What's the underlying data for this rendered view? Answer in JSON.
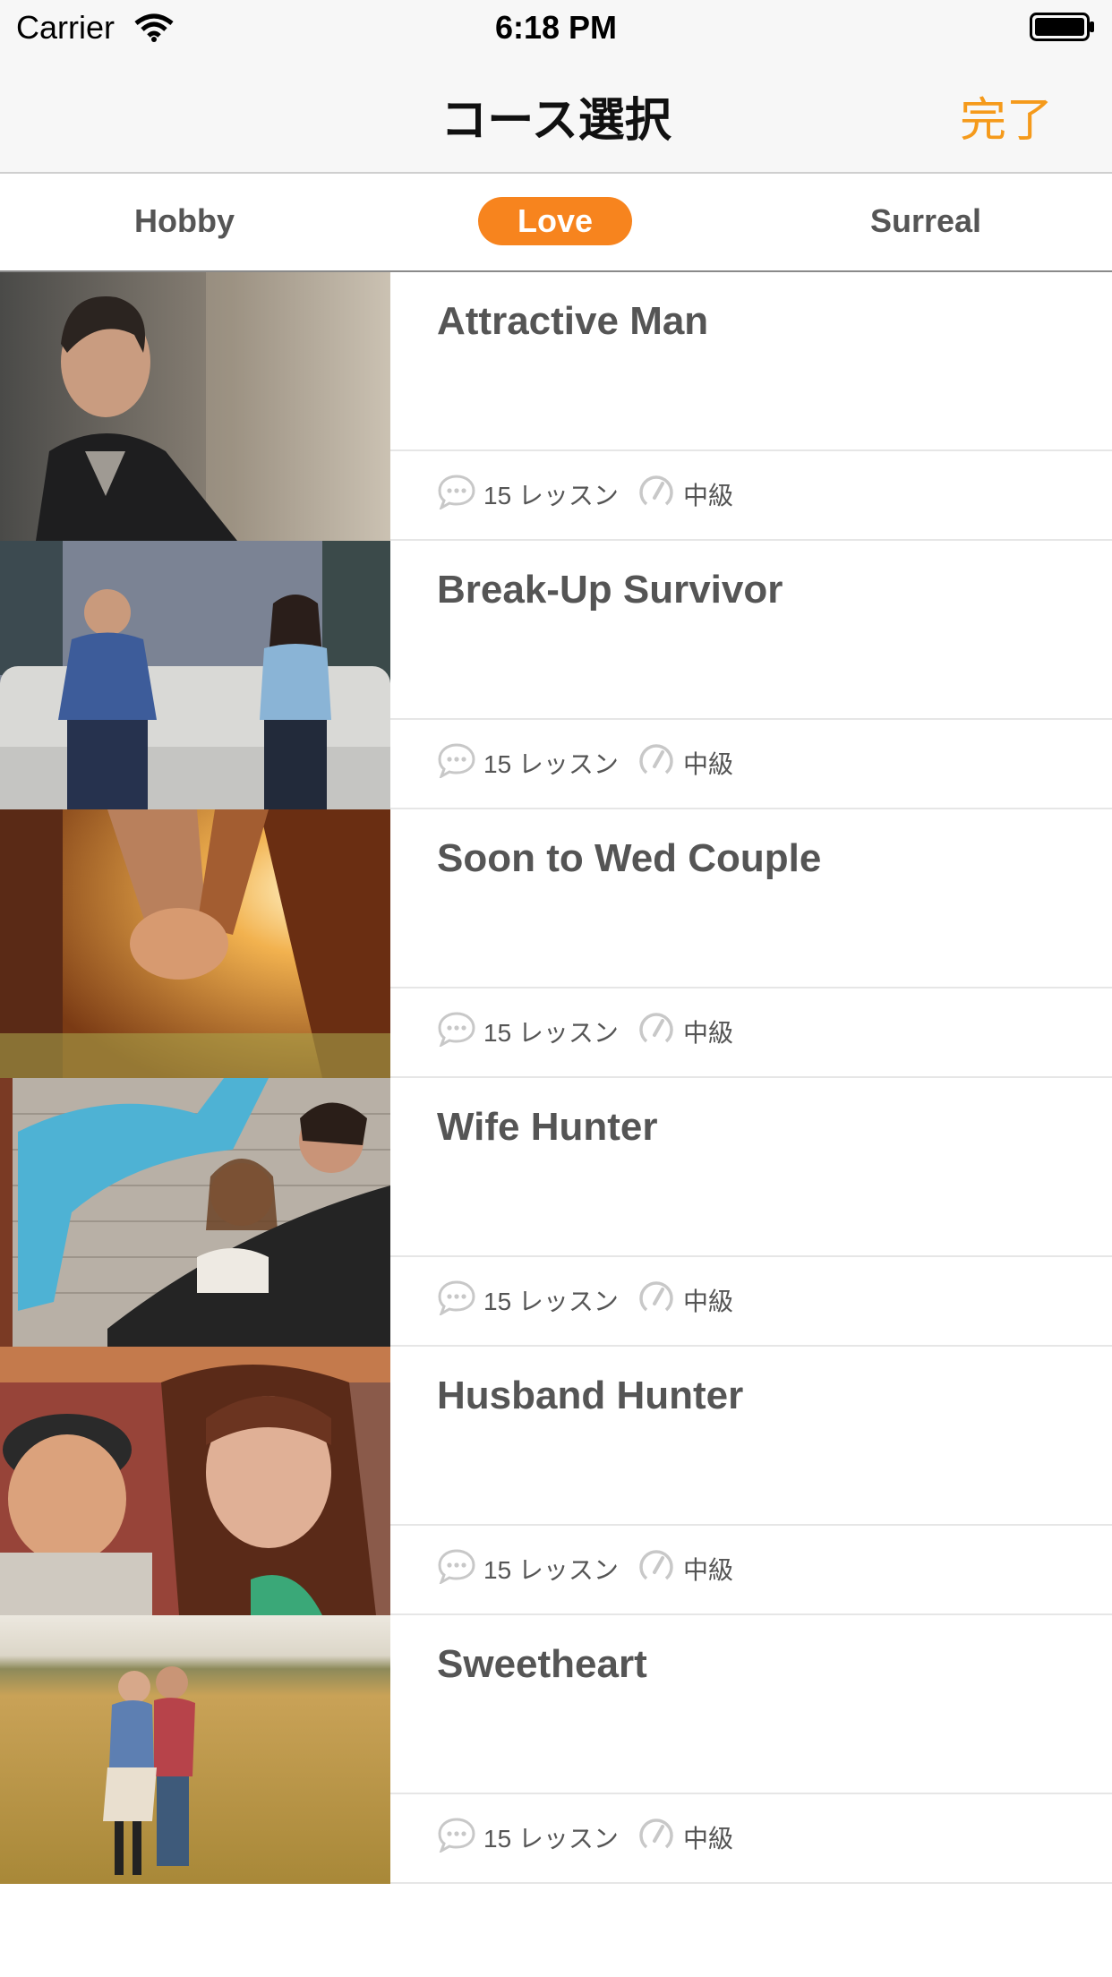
{
  "status_bar": {
    "carrier": "Carrier",
    "time": "6:18 PM"
  },
  "nav": {
    "title": "コース選択",
    "done_label": "完了"
  },
  "tabs": [
    {
      "label": "Hobby",
      "selected": false
    },
    {
      "label": "Love",
      "selected": true
    },
    {
      "label": "Surreal",
      "selected": false
    }
  ],
  "courses": [
    {
      "title": "Attractive Man",
      "lessons": "15 レッスン",
      "level": "中級",
      "image": "man-portrait-photo"
    },
    {
      "title": "Break-Up Survivor",
      "lessons": "15 レッスン",
      "level": "中級",
      "image": "couple-on-sofa-photo"
    },
    {
      "title": "Soon to Wed Couple",
      "lessons": "15 レッスン",
      "level": "中級",
      "image": "holding-hands-sunset-photo"
    },
    {
      "title": "Wife Hunter",
      "lessons": "15 レッスン",
      "level": "中級",
      "image": "couple-brick-wall-photo"
    },
    {
      "title": "Husband Hunter",
      "lessons": "15 レッスン",
      "level": "中級",
      "image": "couple-portrait-photo"
    },
    {
      "title": "Sweetheart",
      "lessons": "15 レッスン",
      "level": "中級",
      "image": "couple-kissing-field-photo"
    }
  ],
  "colors": {
    "accent": "#f7841e",
    "done": "#f59a1b",
    "text": "#555555",
    "icon": "#c8c8c8"
  }
}
